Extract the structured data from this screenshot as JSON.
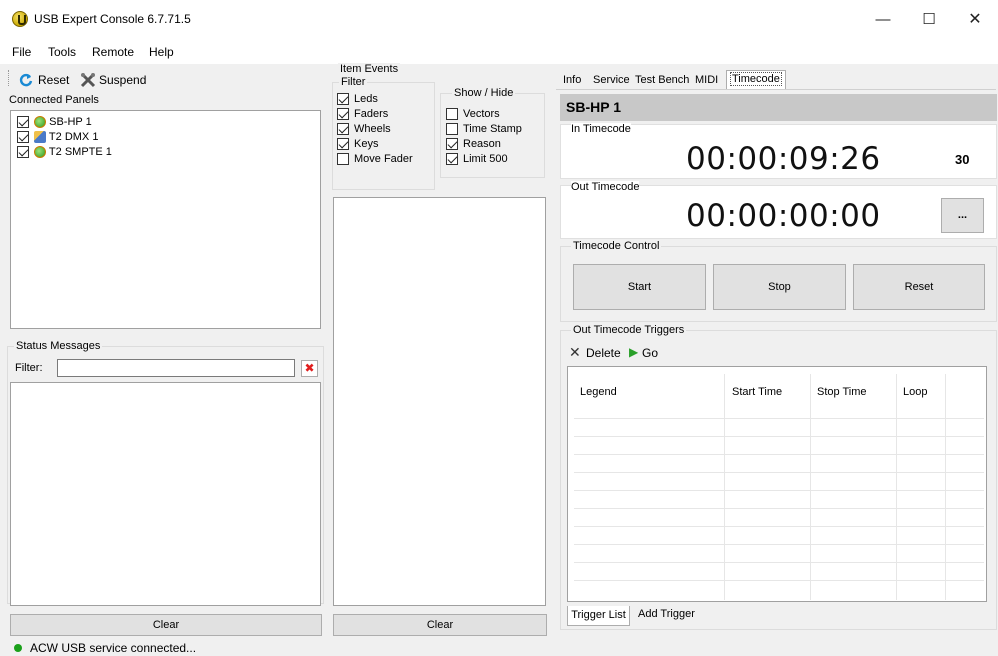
{
  "window": {
    "title": "USB Expert Console 6.7.71.5"
  },
  "menu": [
    "File",
    "Tools",
    "Remote",
    "Help"
  ],
  "toolbar": {
    "reset": "Reset",
    "suspend": "Suspend"
  },
  "connected_panels": {
    "caption": "Connected Panels",
    "items": [
      "SB-HP 1",
      "T2 DMX 1",
      "T2 SMPTE 1"
    ]
  },
  "status_messages": {
    "caption": "Status Messages",
    "filter_label": "Filter:",
    "filter_value": "",
    "clear": "Clear"
  },
  "item_events": {
    "caption": "Item Events",
    "filter_caption": "Filter",
    "filter": [
      {
        "label": "Leds",
        "checked": true
      },
      {
        "label": "Faders",
        "checked": true
      },
      {
        "label": "Wheels",
        "checked": true
      },
      {
        "label": "Keys",
        "checked": true
      },
      {
        "label": "Move Fader",
        "checked": false
      }
    ],
    "showhide_caption": "Show / Hide",
    "showhide": [
      {
        "label": "Vectors",
        "checked": false
      },
      {
        "label": "Time Stamp",
        "checked": false
      },
      {
        "label": "Reason",
        "checked": true
      },
      {
        "label": "Limit 500",
        "checked": true
      }
    ],
    "clear": "Clear"
  },
  "tabs": [
    "Info",
    "Service",
    "Test Bench",
    "MIDI",
    "Timecode"
  ],
  "active_tab": "Timecode",
  "timecode": {
    "panel_title": "SB-HP 1",
    "in_caption": "In Timecode",
    "in_value": "00:00:09:26",
    "fps": "30",
    "out_caption": "Out Timecode",
    "out_value": "00:00:00:00",
    "ellipsis": "...",
    "control_caption": "Timecode Control",
    "start": "Start",
    "stop": "Stop",
    "reset": "Reset",
    "triggers_caption": "Out Timecode Triggers",
    "delete": "Delete",
    "go": "Go",
    "columns": [
      "Legend",
      "Start Time",
      "Stop Time",
      "Loop"
    ],
    "bottom_tabs": [
      "Trigger List",
      "Add Trigger"
    ]
  },
  "status_bar": "ACW USB service connected...",
  "colors": {
    "status_dot": "#1aa01a",
    "panel_header": "#c8c8c8",
    "clear_x": "#e01e1e"
  }
}
